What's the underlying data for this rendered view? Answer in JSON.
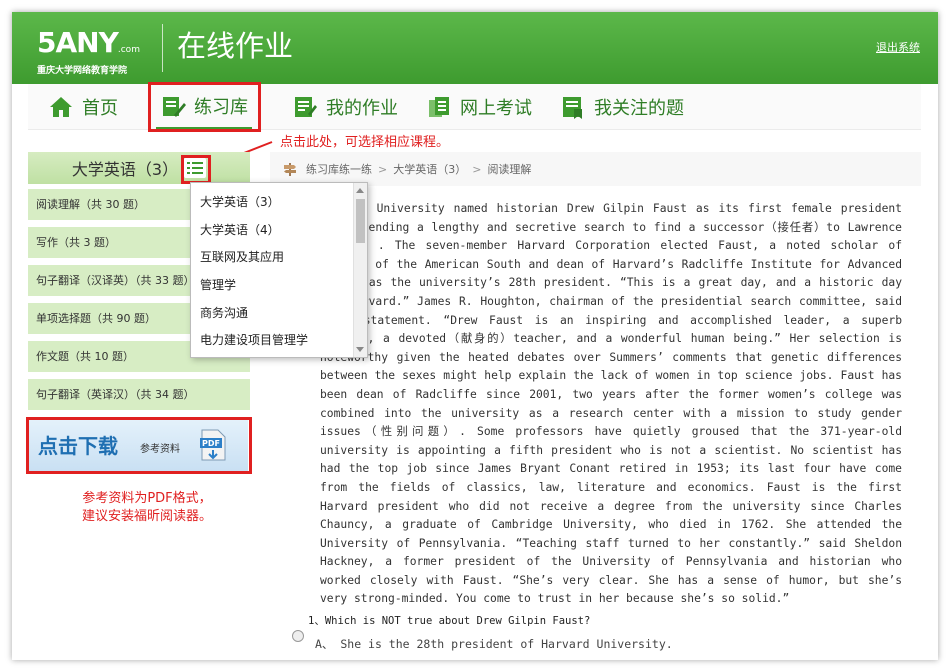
{
  "header": {
    "logo_main": "5ANY",
    "logo_com": ".com",
    "logo_sub": "重庆大学网络教育学院",
    "title": "在线作业",
    "logout": "退出系统"
  },
  "nav": {
    "items": [
      {
        "label": "首页",
        "icon": "home-icon"
      },
      {
        "label": "练习库",
        "icon": "practice-icon"
      },
      {
        "label": "我的作业",
        "icon": "homework-icon"
      },
      {
        "label": "网上考试",
        "icon": "exam-icon"
      },
      {
        "label": "我关注的题",
        "icon": "bookmark-icon"
      }
    ],
    "active": "练习库"
  },
  "annotations": {
    "course_hint": "点击此处，可选择相应课程。",
    "pdf_hint_line1": "参考资料为PDF格式，",
    "pdf_hint_line2": "建议安装福昕阅读器。"
  },
  "sidebar": {
    "course": "大学英语（3）",
    "categories": [
      "阅读理解（共 30 题）",
      "写作（共 3 题）",
      "句子翻译（汉译英）（共 33 题）",
      "单项选择题（共 90 题）",
      "作文题（共 10 题）",
      "句子翻译（英译汉）（共 34 题）"
    ],
    "download_big": "点击下载",
    "download_small": "参考资料",
    "pdf_label": "PDF"
  },
  "dropdown": {
    "options": [
      "大学英语（3）",
      "大学英语（4）",
      "互联网及其应用",
      "管理学",
      "商务沟通",
      "电力建设项目管理学"
    ]
  },
  "breadcrumb": [
    "练习库练一练",
    "大学英语（3）",
    "阅读理解"
  ],
  "passage": "Harvard University named historian Drew Gilpin Faust as its first female president today, ending a lengthy and secretive search to find a successor（接任者）to Lawrence Summers . The seven-member Harvard Corporation elected Faust, a noted scholar of history of the American South and dean of Harvard’s Radcliffe Institute for Advanced Study, as the university’s 28th president. “This is a great day, and a historic day for Harvard.” James R. Houghton, chairman of the presidential search committee, said in a statement. “Drew Faust is an inspiring and accomplished leader, a superb scholar, a devoted（献身的）teacher, and a wonderful human being.” Her selection is noteworthy given the heated debates over Summers’ comments that genetic differences between the sexes might help explain the lack of women in top science jobs. Faust has been dean of Radcliffe since 2001, two years after the former women’s college was combined into the university as a research center with a mission to study gender issues（性别问题）. Some professors have quietly groused that the 371-year-old university is appointing a fifth president who is not a scientist. No scientist has had the top job since James Bryant Conant retired in 1953; its last four have come from the fields of classics, law, literature and economics. Faust is the first Harvard president who did not receive a degree from the university since Charles Chauncy, a graduate of Cambridge University, who died in 1762. She attended the University of Pennsylvania. “Teaching staff turned to her constantly.” said Sheldon Hackney, a former president of the University of Pennsylvania and historian who worked closely with Faust. “She’s very clear. She has a sense of humor, but she’s very strong-minded. You come to trust in her because she’s so solid.”",
  "question": {
    "text": "1、Which is NOT true about Drew Gilpin Faust?",
    "option_a": "A、  She is the 28th president of Harvard University."
  },
  "colors": {
    "header_green": "#3e9b2f",
    "nav_text_green": "#2f7d26",
    "sidebar_green": "#d7edc4",
    "annotation_red": "#e02020"
  }
}
